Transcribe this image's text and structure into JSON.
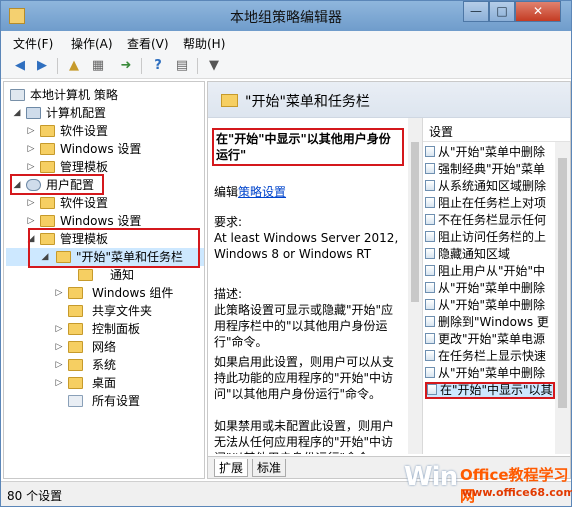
{
  "window": {
    "title": "本地组策略编辑器",
    "min": "—",
    "max": "□",
    "close": "✕"
  },
  "menu": [
    "文件(F)",
    "操作(A)",
    "查看(V)",
    "帮助(H)"
  ],
  "tree": [
    {
      "label": "本地计算机 策略"
    },
    {
      "label": "计算机配置"
    },
    {
      "label": "软件设置"
    },
    {
      "label": "Windows 设置"
    },
    {
      "label": "管理模板"
    },
    {
      "label": "用户配置"
    },
    {
      "label": "软件设置"
    },
    {
      "label": "Windows 设置"
    },
    {
      "label": "管理模板"
    },
    {
      "label": "\"开始\"菜单和任务栏"
    },
    {
      "label": "通知"
    },
    {
      "label": "Windows 组件"
    },
    {
      "label": "共享文件夹"
    },
    {
      "label": "控制面板"
    },
    {
      "label": "网络"
    },
    {
      "label": "系统"
    },
    {
      "label": "桌面"
    },
    {
      "label": "所有设置"
    }
  ],
  "details": {
    "header": "\"开始\"菜单和任务栏",
    "policy_title": "在\"开始\"中显示\"以其他用户身份运行\"",
    "edit_prefix": "编辑",
    "edit_link": "策略设置",
    "requirements_label": "要求:",
    "requirements": "At least Windows Server 2012, Windows 8 or Windows RT",
    "description_label": "描述:",
    "description": "此策略设置可显示或隐藏\"开始\"应用程序栏中的\"以其他用户身份运行\"命令。",
    "enabled_text": "如果启用此设置，则用户可以从支持此功能的应用程序的\"开始\"中访问\"以其他用户身份运行\"命令。",
    "disabled_text": "如果禁用或未配置此设置，则用户无法从任何应用程序的\"开始\"中访问\"以其他用户身份运行\"命令。"
  },
  "list": {
    "header": "设置",
    "items": [
      "从\"开始\"菜单中删除",
      "强制经典\"开始\"菜单",
      "从系统通知区域删除",
      "阻止在任务栏上对项",
      "不在任务栏显示任何",
      "阻止访问任务栏的上",
      "隐藏通知区域",
      "阻止用户从\"开始\"中",
      "从\"开始\"菜单中删除",
      "从\"开始\"菜单中删除",
      "删除到\"Windows 更",
      "更改\"开始\"菜单电源",
      "在任务栏上显示快速",
      "从\"开始\"菜单中删除",
      "在\"开始\"中显示\"以其"
    ]
  },
  "tabs": [
    "扩展",
    "标准"
  ],
  "status": "80 个设置",
  "watermark": {
    "win": "Win",
    "office": "Office教程学习网",
    "url": "www.office68.com"
  },
  "colors": {
    "accent": "#6f9ccb",
    "highlight_box": "#d4181c",
    "selected_row": "#cde8ff",
    "link": "#0044cc"
  }
}
